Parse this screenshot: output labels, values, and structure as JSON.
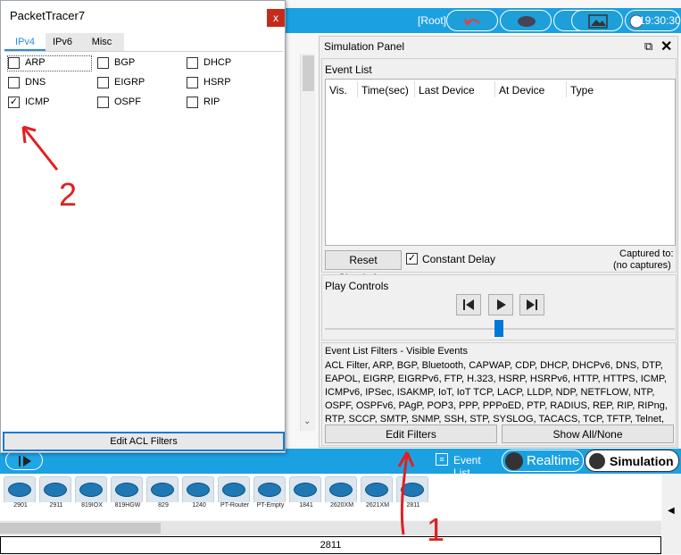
{
  "topbar": {
    "root_label": "[Root]",
    "clock": "19:30:30"
  },
  "simulation_panel": {
    "title": "Simulation Panel",
    "event_list": {
      "label": "Event List",
      "columns": [
        "Vis.",
        "Time(sec)",
        "Last Device",
        "At Device",
        "Type"
      ]
    },
    "reset_button": "Reset Simulation",
    "constant_delay": {
      "label": "Constant Delay",
      "checked": true
    },
    "captured_to": "Captured to:",
    "captured_value": "(no captures)",
    "play_controls": {
      "label": "Play Controls"
    },
    "filters": {
      "label": "Event List Filters - Visible Events",
      "text": "ACL Filter, ARP, BGP, Bluetooth, CAPWAP, CDP, DHCP, DHCPv6, DNS, DTP, EAPOL, EIGRP, EIGRPv6, FTP, H.323, HSRP, HSRPv6, HTTP, HTTPS, ICMP, ICMPv6, IPSec, ISAKMP, IoT, IoT TCP, LACP, LLDP, NDP, NETFLOW, NTP, OSPF, OSPFv6, PAgP, POP3, PPP, PPPoED, PTP, RADIUS, REP, RIP, RIPng, RTP, SCCP, SMTP, SNMP, SSH, STP, SYSLOG, TACACS, TCP, TFTP, Telnet, UDP, USB, VTP"
    },
    "edit_filters_button": "Edit Filters",
    "show_all_button": "Show All/None"
  },
  "bottombar": {
    "event_list_button": "Event List",
    "realtime_label": "Realtime",
    "simulation_label": "Simulation"
  },
  "devices": [
    "2901",
    "2911",
    "819IOX",
    "819HGW",
    "829",
    "1240",
    "PT-Router",
    "PT-Empty",
    "1841",
    "2620XM",
    "2621XM",
    "2811"
  ],
  "selected_device_label": "2811",
  "dialog": {
    "title": "PacketTracer7",
    "close_symbol": "x",
    "tabs": [
      "IPv4",
      "IPv6",
      "Misc"
    ],
    "active_tab": "IPv4",
    "protocols": [
      {
        "label": "ARP",
        "checked": false
      },
      {
        "label": "BGP",
        "checked": false
      },
      {
        "label": "DHCP",
        "checked": false
      },
      {
        "label": "DNS",
        "checked": false
      },
      {
        "label": "EIGRP",
        "checked": false
      },
      {
        "label": "HSRP",
        "checked": false
      },
      {
        "label": "ICMP",
        "checked": true
      },
      {
        "label": "OSPF",
        "checked": false
      },
      {
        "label": "RIP",
        "checked": false
      }
    ],
    "edit_acl_button": "Edit ACL Filters"
  },
  "annotations": {
    "number_1": "1",
    "number_2": "2",
    "color": "#e02020"
  },
  "colors": {
    "accent_blue": "#1ba1e2",
    "annotation_red": "#e02020"
  }
}
